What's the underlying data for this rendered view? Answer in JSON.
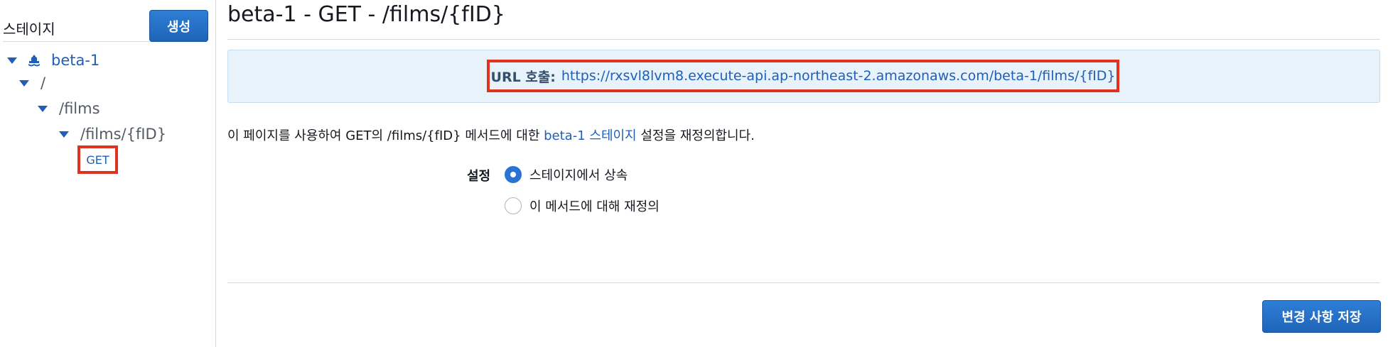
{
  "sidebar": {
    "title": "스테이지",
    "create_label": "생성",
    "tree": {
      "stage": "beta-1",
      "root": "/",
      "films": "/films",
      "film_id": "/films/{fID}",
      "method": "GET"
    }
  },
  "main": {
    "title": "beta-1 - GET - /films/{fID}",
    "url_label": "URL 호출:",
    "url_value": "https://rxsvl8lvm8.execute-api.ap-northeast-2.amazonaws.com/beta-1/films/{fID}",
    "description": {
      "before": "이 페이지를 사용하여 GET의 /films/{fID} 메서드에 대한 ",
      "link": "beta-1 스테이지",
      "after": " 설정을 재정의합니다."
    },
    "settings": {
      "label": "설정",
      "options": [
        {
          "label": "스테이지에서 상속",
          "selected": true
        },
        {
          "label": "이 메서드에 대해 재정의",
          "selected": false
        }
      ]
    },
    "save_label": "변경 사항 저장"
  },
  "colors": {
    "accent": "#1f5fb6",
    "primary_button": "#2e7fd6",
    "highlight_border": "#e0321f",
    "url_banner_bg": "#e8f2fa"
  }
}
